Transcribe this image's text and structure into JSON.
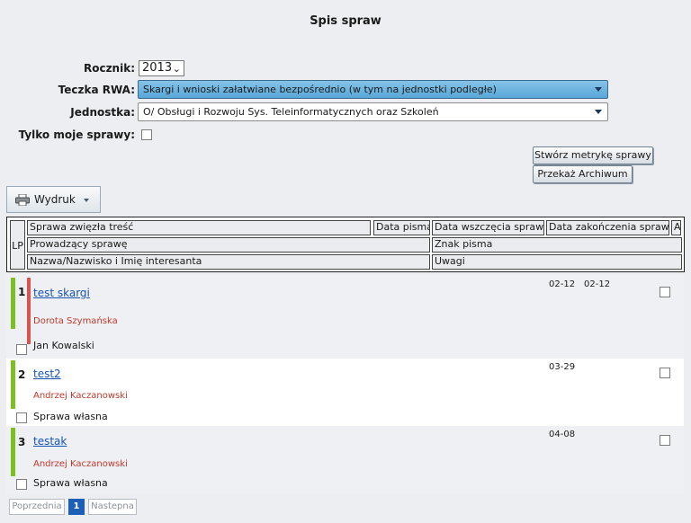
{
  "page": {
    "title": "Spis spraw"
  },
  "filters": {
    "rocznik_label": "Rocznik:",
    "rocznik_value": "2013",
    "teczka_label": "Teczka RWA:",
    "teczka_value": "Skargi i wnioski załatwiane bezpośrednio (w tym na jednostki podległe)",
    "jednostka_label": "Jednostka:",
    "jednostka_value": "O/ Obsługi i Rozwoju Sys. Teleinformatycznych oraz Szkoleń",
    "tylko_moje_label": "Tylko moje sprawy:"
  },
  "actions": {
    "create": "Stwórz metrykę sprawy",
    "archive": "Przekaż Archiwum",
    "print": "Wydruk"
  },
  "table": {
    "headers": {
      "lp": "LP",
      "tresc": "Sprawa zwięzła treść",
      "data_pisma": "Data pisma",
      "data_wszczecia": "Data wszczęcia sprawy",
      "data_zakonczenia": "Data zakończenia sprawy",
      "a": "A",
      "prowadzacy": "Prowadzący sprawę",
      "znak": "Znak pisma",
      "petent": "Nazwa/Nazwisko i Imię interesanta",
      "uwagi": "Uwagi"
    },
    "rows": [
      {
        "lp": "1",
        "title": "test skargi",
        "person": "Dorota Szymańska",
        "petent": "Jan Kowalski",
        "data_wszczecia": "02-12",
        "data_zakonczenia": "02-12"
      },
      {
        "lp": "2",
        "title": "test2",
        "person": "Andrzej Kaczanowski",
        "petent": "Sprawa własna",
        "data_wszczecia": "03-29",
        "data_zakonczenia": ""
      },
      {
        "lp": "3",
        "title": "testak",
        "person": "Andrzej Kaczanowski",
        "petent": "Sprawa własna",
        "data_wszczecia": "04-08",
        "data_zakonczenia": ""
      }
    ]
  },
  "pagination": {
    "prev": "Poprzednia",
    "current": "1",
    "next": "Nastepna"
  },
  "colors": {
    "accent": "#1d5fb7",
    "status_green": "#7cbf22",
    "status_red": "#d9534f",
    "person_red": "#c0392b"
  }
}
